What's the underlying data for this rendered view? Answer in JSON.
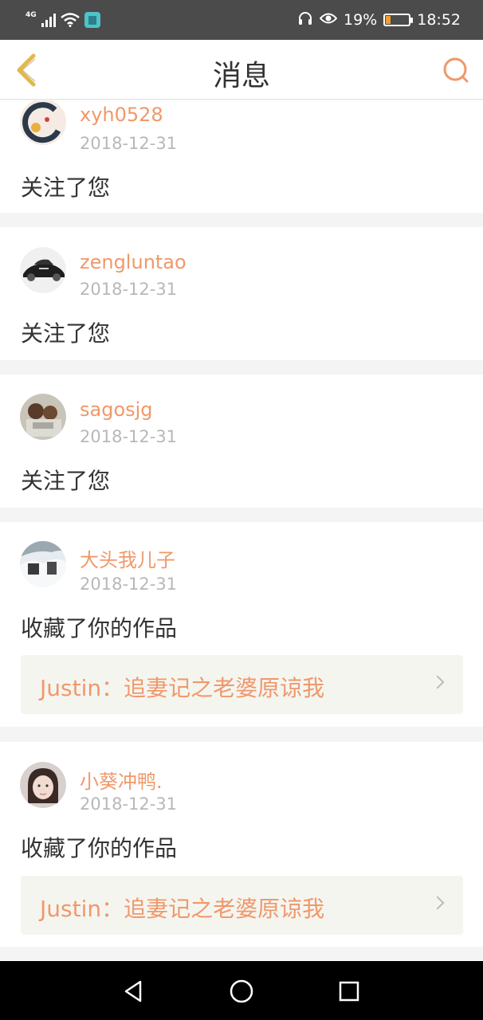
{
  "status_bar": {
    "network": "4G",
    "battery": "19%",
    "time": "18:52",
    "icons": [
      "signal-icon",
      "wifi-icon",
      "app-notification-icon",
      "headphones-icon",
      "eye-icon",
      "battery-icon"
    ],
    "battery_level": 0.19,
    "battery_color": "#f0a030"
  },
  "header": {
    "title": "消息",
    "back_icon": "chevron-left-icon",
    "search_icon": "search-icon",
    "accent": "#f0986a",
    "back_color": "#e2b84a"
  },
  "messages": [
    {
      "username": "xyh0528",
      "date": "2018-12-31",
      "action": "关注了您"
    },
    {
      "username": "zengluntao",
      "date": "2018-12-31",
      "action": "关注了您"
    },
    {
      "username": "sagosjg",
      "date": "2018-12-31",
      "action": "关注了您"
    },
    {
      "username": "大头我儿子",
      "date": "2018-12-31",
      "action": "收藏了你的作品",
      "work": "Justin：追妻记之老婆原谅我"
    },
    {
      "username": "小葵冲鸭.",
      "date": "2018-12-31",
      "action": "收藏了你的作品",
      "work": "Justin：追妻记之老婆原谅我"
    }
  ],
  "nav_bar": {
    "buttons": [
      "back-triangle-icon",
      "home-circle-icon",
      "recents-square-icon"
    ]
  }
}
